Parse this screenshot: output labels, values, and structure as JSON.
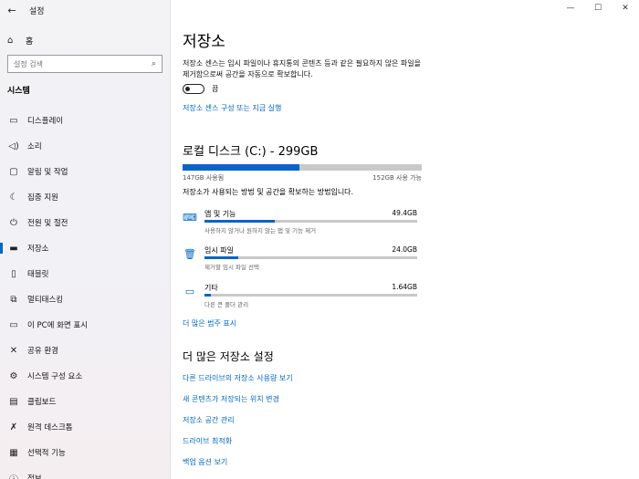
{
  "window": {
    "title": "설정",
    "controls": [
      "—",
      "☐",
      "✕"
    ]
  },
  "sidebar": {
    "back_icon": "←",
    "home": {
      "icon": "⌂",
      "label": "홈"
    },
    "search": {
      "placeholder": "설정 검색",
      "icon": "⌕"
    },
    "section": "시스템",
    "items": [
      {
        "icon": "▭",
        "label": "디스플레이"
      },
      {
        "icon": "◁)",
        "label": "소리"
      },
      {
        "icon": "▢",
        "label": "알림 및 작업"
      },
      {
        "icon": "☾",
        "label": "집중 지원"
      },
      {
        "icon": "⏻",
        "label": "전원 및 절전"
      },
      {
        "icon": "▬",
        "label": "저장소",
        "active": true
      },
      {
        "icon": "▯",
        "label": "태블릿"
      },
      {
        "icon": "⧉",
        "label": "멀티태스킹"
      },
      {
        "icon": "▭",
        "label": "이 PC에 화면 표시"
      },
      {
        "icon": "✕",
        "label": "공유 환경"
      },
      {
        "icon": "⚙",
        "label": "시스템 구성 요소"
      },
      {
        "icon": "▤",
        "label": "클립보드"
      },
      {
        "icon": "✗",
        "label": "원격 데스크톱"
      },
      {
        "icon": "▦",
        "label": "선택적 기능"
      },
      {
        "icon": "ⓘ",
        "label": "정보"
      }
    ]
  },
  "main": {
    "title": "저장소",
    "description": "저장소 센스는 임시 파일이나 휴지통의 콘텐츠 등과 같은 필요하지 않은 파일을 제거함으로써 공간을 자동으로 확보합니다.",
    "toggle_label": "끔",
    "toggle_on": false,
    "configure_link": "저장소 센스 구성 또는 지금 실행",
    "disk_title": "로컬 디스크 (C:) - 299GB",
    "used_label": "147GB 사용됨",
    "available_label": "152GB 사용 가능",
    "used_fraction": 0.49,
    "how_text": "저장소가 사용되는 방법 및 공간을 확보하는 방법입니다.",
    "categories": [
      {
        "icon": "⌨",
        "name": "앱 및 기능",
        "size": "49.4GB",
        "sub": "사용하지 않거나 원하지 않는 앱 및 기능 제거",
        "fraction": 0.33
      },
      {
        "icon": "🗑",
        "name": "임시 파일",
        "size": "24.0GB",
        "sub": "제거할 임시 파일 선택",
        "fraction": 0.16
      },
      {
        "icon": "▭",
        "name": "기타",
        "size": "1.64GB",
        "sub": "다른 큰 폴더 관리",
        "fraction": 0.03
      }
    ],
    "show_more_link": "더 많은 범주 표시",
    "more_settings_title": "더 많은 저장소 설정",
    "more_links": [
      "다른 드라이브의 저장소 사용량 보기",
      "새 콘텐츠가 저장되는 위치 변경",
      "저장소 공간 관리",
      "드라이브 최적화",
      "백업 옵션 보기"
    ]
  }
}
